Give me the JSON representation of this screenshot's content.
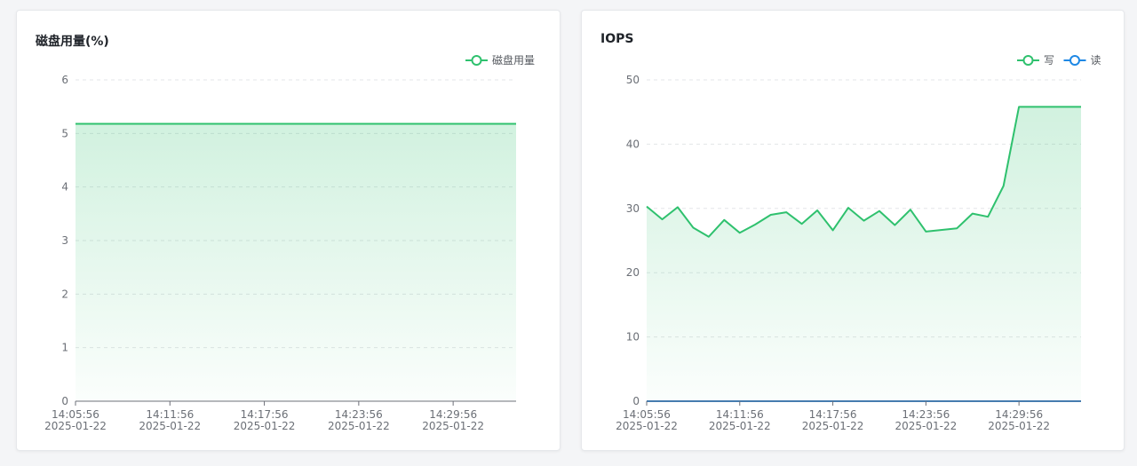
{
  "charts": [
    {
      "title": "磁盘用量(%)"
    },
    {
      "title": "IOPS"
    }
  ],
  "chart_data": [
    {
      "type": "area",
      "title": "磁盘用量(%)",
      "legend_position": "top-right",
      "grid": true,
      "ylim": [
        0,
        6
      ],
      "yticks": [
        "0",
        "1",
        "2",
        "3",
        "4",
        "5",
        "6"
      ],
      "x_range": [
        "14:05:56",
        "14:33:56"
      ],
      "xticks": [
        {
          "time": "14:05:56",
          "date": "2025-01-22"
        },
        {
          "time": "14:11:56",
          "date": "2025-01-22"
        },
        {
          "time": "14:17:56",
          "date": "2025-01-22"
        },
        {
          "time": "14:23:56",
          "date": "2025-01-22"
        },
        {
          "time": "14:29:56",
          "date": "2025-01-22"
        }
      ],
      "x": [
        "14:05:56",
        "14:33:56"
      ],
      "series": [
        {
          "name": "磁盘用量",
          "color": "#2fc16e",
          "values": [
            5.18,
            5.18
          ]
        }
      ]
    },
    {
      "type": "area",
      "title": "IOPS",
      "legend_position": "top-right",
      "grid": true,
      "ylim": [
        0,
        50
      ],
      "yticks": [
        "0",
        "10",
        "20",
        "30",
        "40",
        "50"
      ],
      "x_range": [
        "14:05:56",
        "14:33:56"
      ],
      "xticks": [
        {
          "time": "14:05:56",
          "date": "2025-01-22"
        },
        {
          "time": "14:11:56",
          "date": "2025-01-22"
        },
        {
          "time": "14:17:56",
          "date": "2025-01-22"
        },
        {
          "time": "14:23:56",
          "date": "2025-01-22"
        },
        {
          "time": "14:29:56",
          "date": "2025-01-22"
        }
      ],
      "x": [
        "14:05:56",
        "14:06:56",
        "14:07:56",
        "14:08:56",
        "14:09:56",
        "14:10:56",
        "14:11:56",
        "14:12:56",
        "14:13:56",
        "14:14:56",
        "14:15:56",
        "14:16:56",
        "14:17:56",
        "14:18:56",
        "14:19:56",
        "14:20:56",
        "14:21:56",
        "14:22:56",
        "14:23:56",
        "14:25:56",
        "14:26:56",
        "14:27:56",
        "14:28:56",
        "14:29:56",
        "14:30:56",
        "14:31:56",
        "14:32:56",
        "14:33:56"
      ],
      "series": [
        {
          "name": "写",
          "color": "#2fc16e",
          "values": [
            30.3,
            28.3,
            30.2,
            27.0,
            25.6,
            28.2,
            26.2,
            27.5,
            29.0,
            29.4,
            27.6,
            29.7,
            26.6,
            30.1,
            28.1,
            29.6,
            27.4,
            29.8,
            26.4,
            26.9,
            29.2,
            28.7,
            33.5,
            45.8,
            45.8,
            45.8,
            45.8,
            45.8
          ]
        },
        {
          "name": "读",
          "color": "#1e88e5",
          "values": [
            0,
            0,
            0,
            0,
            0,
            0,
            0,
            0,
            0,
            0,
            0,
            0,
            0,
            0,
            0,
            0,
            0,
            0,
            0,
            0,
            0,
            0,
            0,
            0,
            0,
            0,
            0,
            0
          ]
        }
      ]
    }
  ]
}
